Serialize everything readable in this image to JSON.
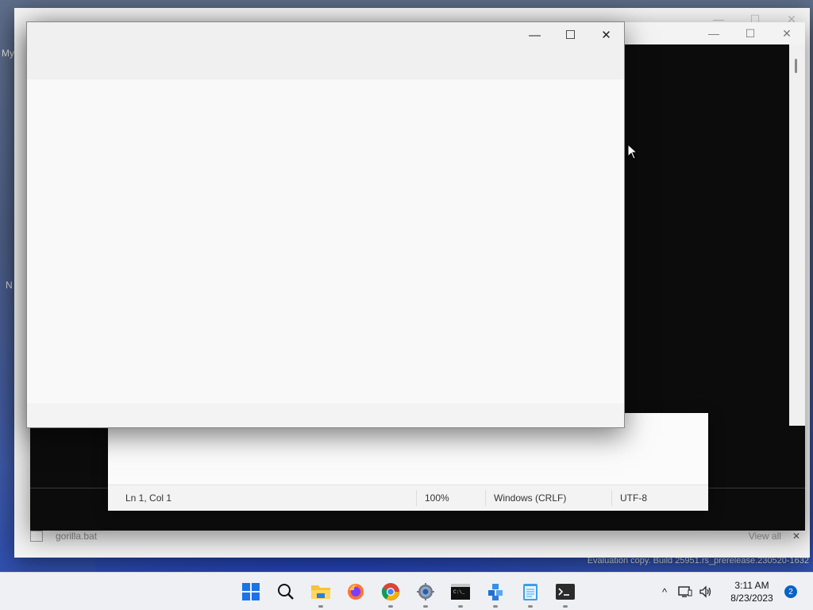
{
  "desktop": {
    "label_my": "My",
    "label_n": "N",
    "evaluation_text": "Evaluation copy. Build 25951.rs_prerelease.230520-1632"
  },
  "explorer": {
    "status_filename": "gorilla.bat",
    "status_right_text": "View all"
  },
  "notepad": {
    "status": {
      "position": "Ln 1, Col 1",
      "zoom": "100%",
      "line_ending": "Windows (CRLF)",
      "encoding": "UTF-8"
    }
  },
  "front_window": {
    "minimize_glyph": "—",
    "maximize_glyph": "☐",
    "close_glyph": "✕"
  },
  "taskbar": {
    "apps": [
      {
        "name": "start",
        "icon": "windows-logo-icon",
        "running": false
      },
      {
        "name": "search",
        "icon": "search-icon",
        "running": false
      },
      {
        "name": "file-explorer",
        "icon": "folder-icon",
        "running": true
      },
      {
        "name": "firefox",
        "icon": "firefox-icon",
        "running": false
      },
      {
        "name": "chrome",
        "icon": "chrome-icon",
        "running": true
      },
      {
        "name": "settings",
        "icon": "gear-icon",
        "running": true
      },
      {
        "name": "command-prompt",
        "icon": "cmd-icon",
        "running": true
      },
      {
        "name": "package",
        "icon": "cubes-icon",
        "running": true
      },
      {
        "name": "notepad",
        "icon": "notepad-icon",
        "running": true
      },
      {
        "name": "terminal",
        "icon": "terminal-icon",
        "running": true
      }
    ],
    "tray": {
      "chevron": "^",
      "time": "3:11 AM",
      "date": "8/23/2023",
      "notification_count": "2"
    }
  },
  "colors": {
    "accent": "#0b62c4",
    "taskbar_bg": "#eef0f4",
    "terminal_bg": "#0c0c0c"
  }
}
